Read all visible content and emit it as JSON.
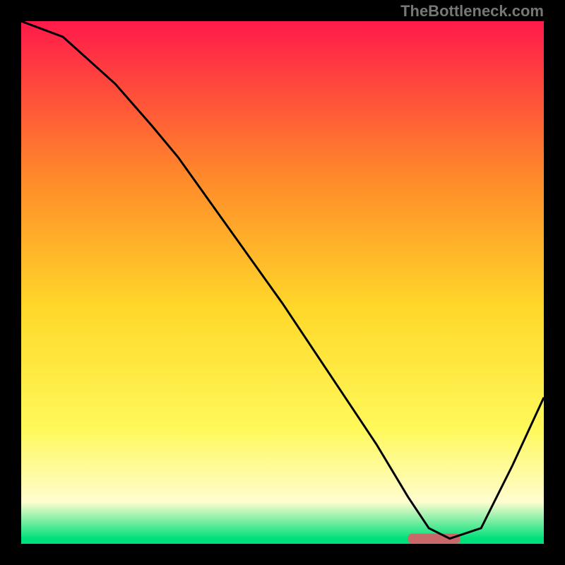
{
  "attribution": "TheBottleneck.com",
  "colors": {
    "frame": "#000000",
    "top": "#ff1a4a",
    "mid_upper": "#ff8a2a",
    "mid": "#ffd82a",
    "mid_lower": "#fff95a",
    "lower_cream": "#fffdd0",
    "bottom": "#00e07a",
    "curve": "#000000",
    "marker": "#c86868"
  },
  "chart_data": {
    "type": "line",
    "title": "",
    "xlabel": "",
    "ylabel": "",
    "xlim": [
      0,
      100
    ],
    "ylim": [
      0,
      100
    ],
    "series": [
      {
        "name": "curve",
        "x": [
          0,
          8,
          18,
          25,
          30,
          40,
          50,
          60,
          68,
          74,
          78,
          82,
          88,
          94,
          100
        ],
        "y": [
          100,
          97,
          88,
          80,
          74,
          60,
          46,
          31,
          19,
          9,
          3,
          1,
          3,
          15,
          28
        ]
      }
    ],
    "marker": {
      "name": "optimal-range",
      "x_start": 74,
      "x_end": 84,
      "y": 1
    }
  }
}
